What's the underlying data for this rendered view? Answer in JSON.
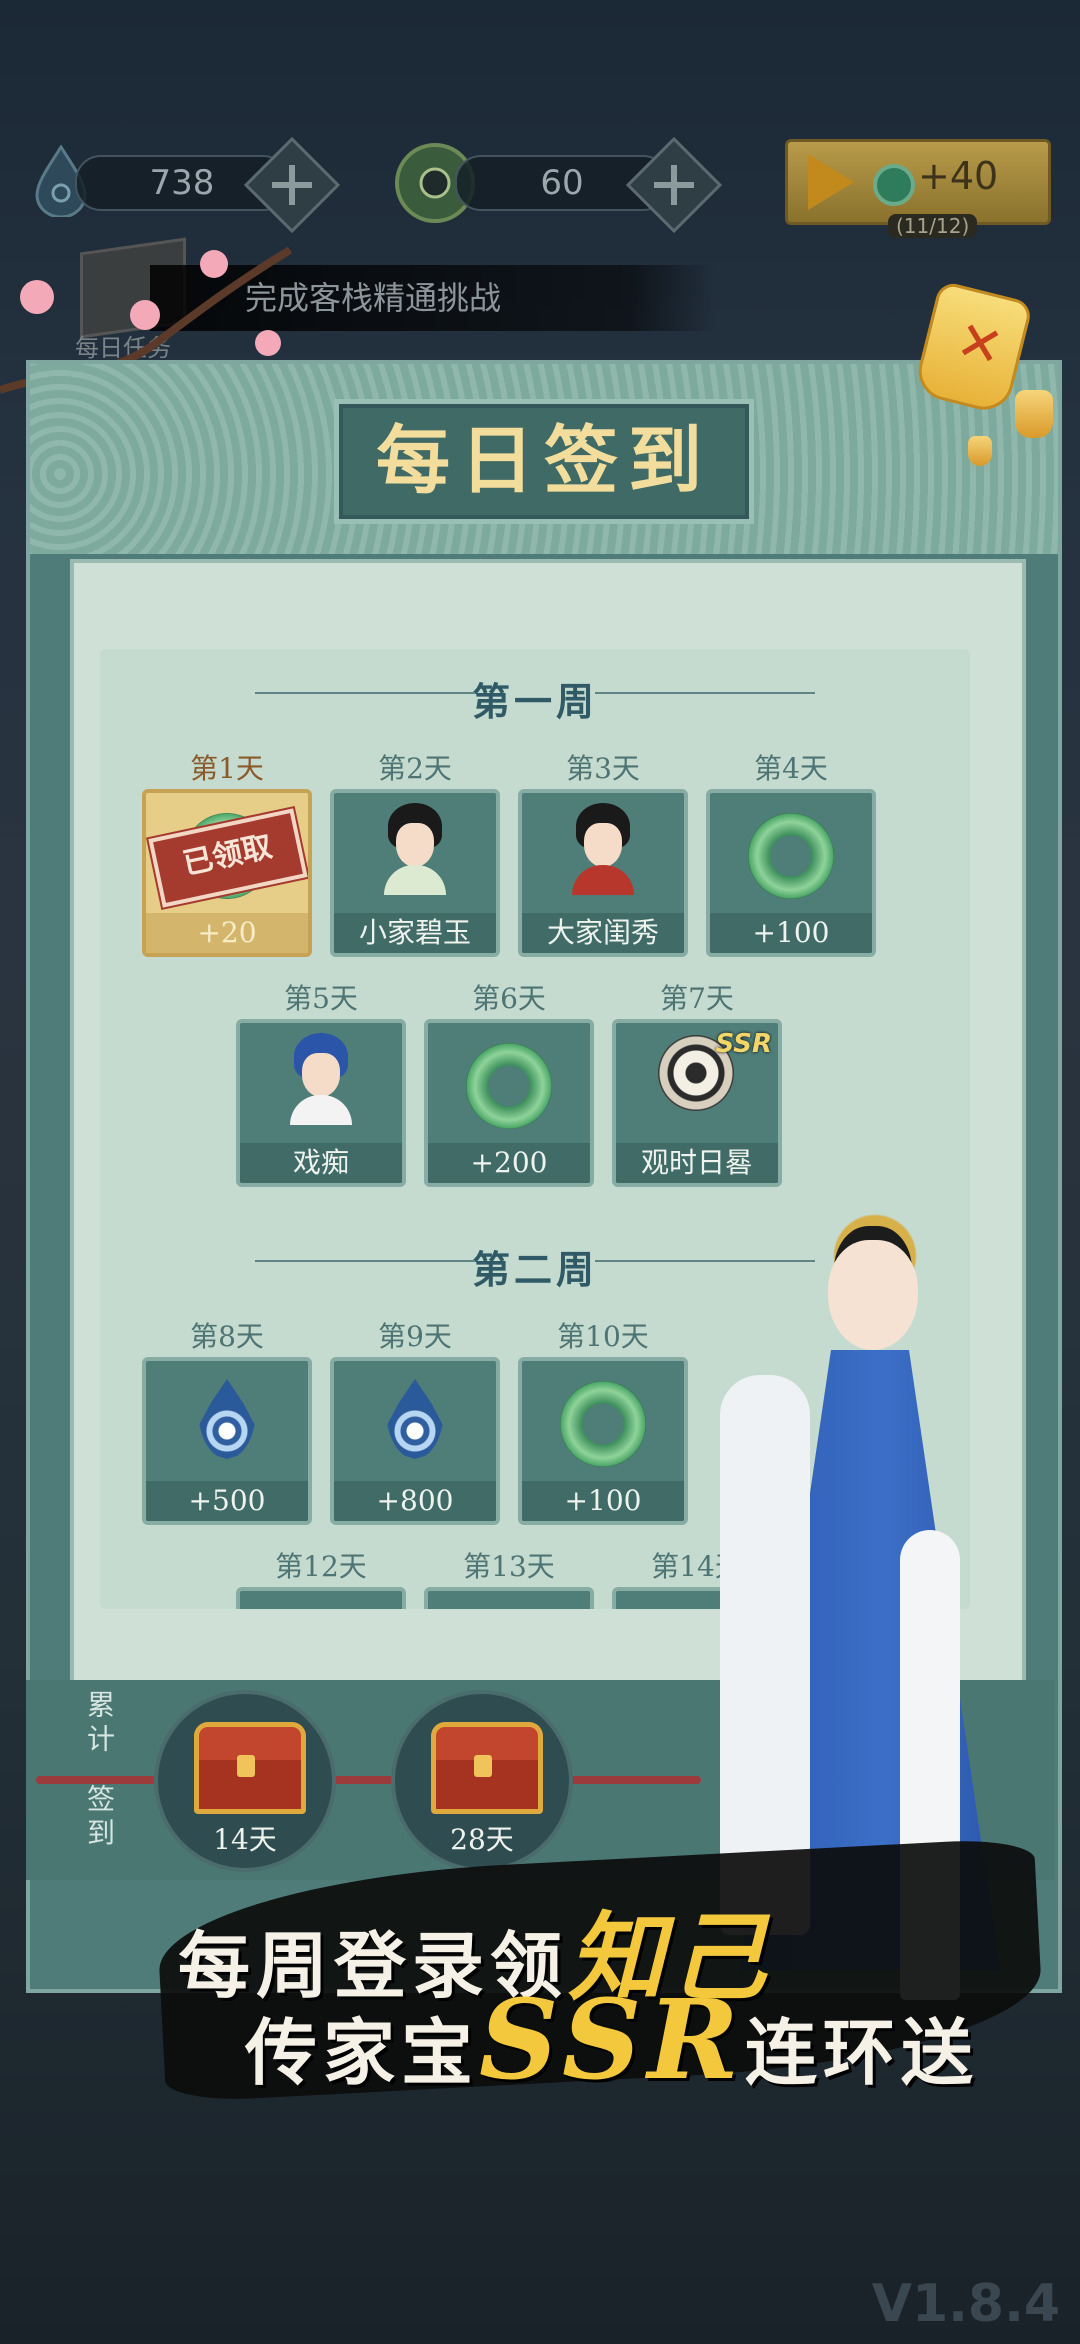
{
  "hud": {
    "spirit_value": "738",
    "jade_value": "60",
    "video_reward": "+40",
    "video_count": "(11/12)"
  },
  "task": {
    "banner_text": "完成客栈精通挑战",
    "label": "每日任务"
  },
  "panel": {
    "title": "每日签到",
    "weeks": [
      {
        "title": "第一周",
        "days": [
          {
            "day": "第1天",
            "reward": "+20",
            "claimed_stamp": "已领取"
          },
          {
            "day": "第2天",
            "reward": "小家碧玉"
          },
          {
            "day": "第3天",
            "reward": "大家闺秀"
          },
          {
            "day": "第4天",
            "reward": "+100"
          },
          {
            "day": "第5天",
            "reward": "戏痴"
          },
          {
            "day": "第6天",
            "reward": "+200"
          },
          {
            "day": "第7天",
            "reward": "观时日晷",
            "tag": "SSR"
          }
        ]
      },
      {
        "title": "第二周",
        "days": [
          {
            "day": "第8天",
            "reward": "+500"
          },
          {
            "day": "第9天",
            "reward": "+800"
          },
          {
            "day": "第10天",
            "reward": "+100"
          },
          {
            "day": "第12天"
          },
          {
            "day": "第13天"
          },
          {
            "day": "第14天"
          }
        ]
      }
    ],
    "accumulate": {
      "label_top": "累计",
      "label_bottom": "签到",
      "milestones": [
        "14天",
        "28天"
      ]
    }
  },
  "slogan": {
    "line1_a": "每周登录领",
    "line1_b": "知己",
    "line2_a": "传家宝",
    "line2_b": "SSR",
    "line2_c": "连环送"
  },
  "version": "V1.8.4",
  "colors": {
    "panel_teal": "#4f7c78",
    "paper": "#cfe0d6",
    "title_gold": "#f2dd9c",
    "claimed_gold": "#e7ce88",
    "stamp_red": "#a53a2e"
  }
}
